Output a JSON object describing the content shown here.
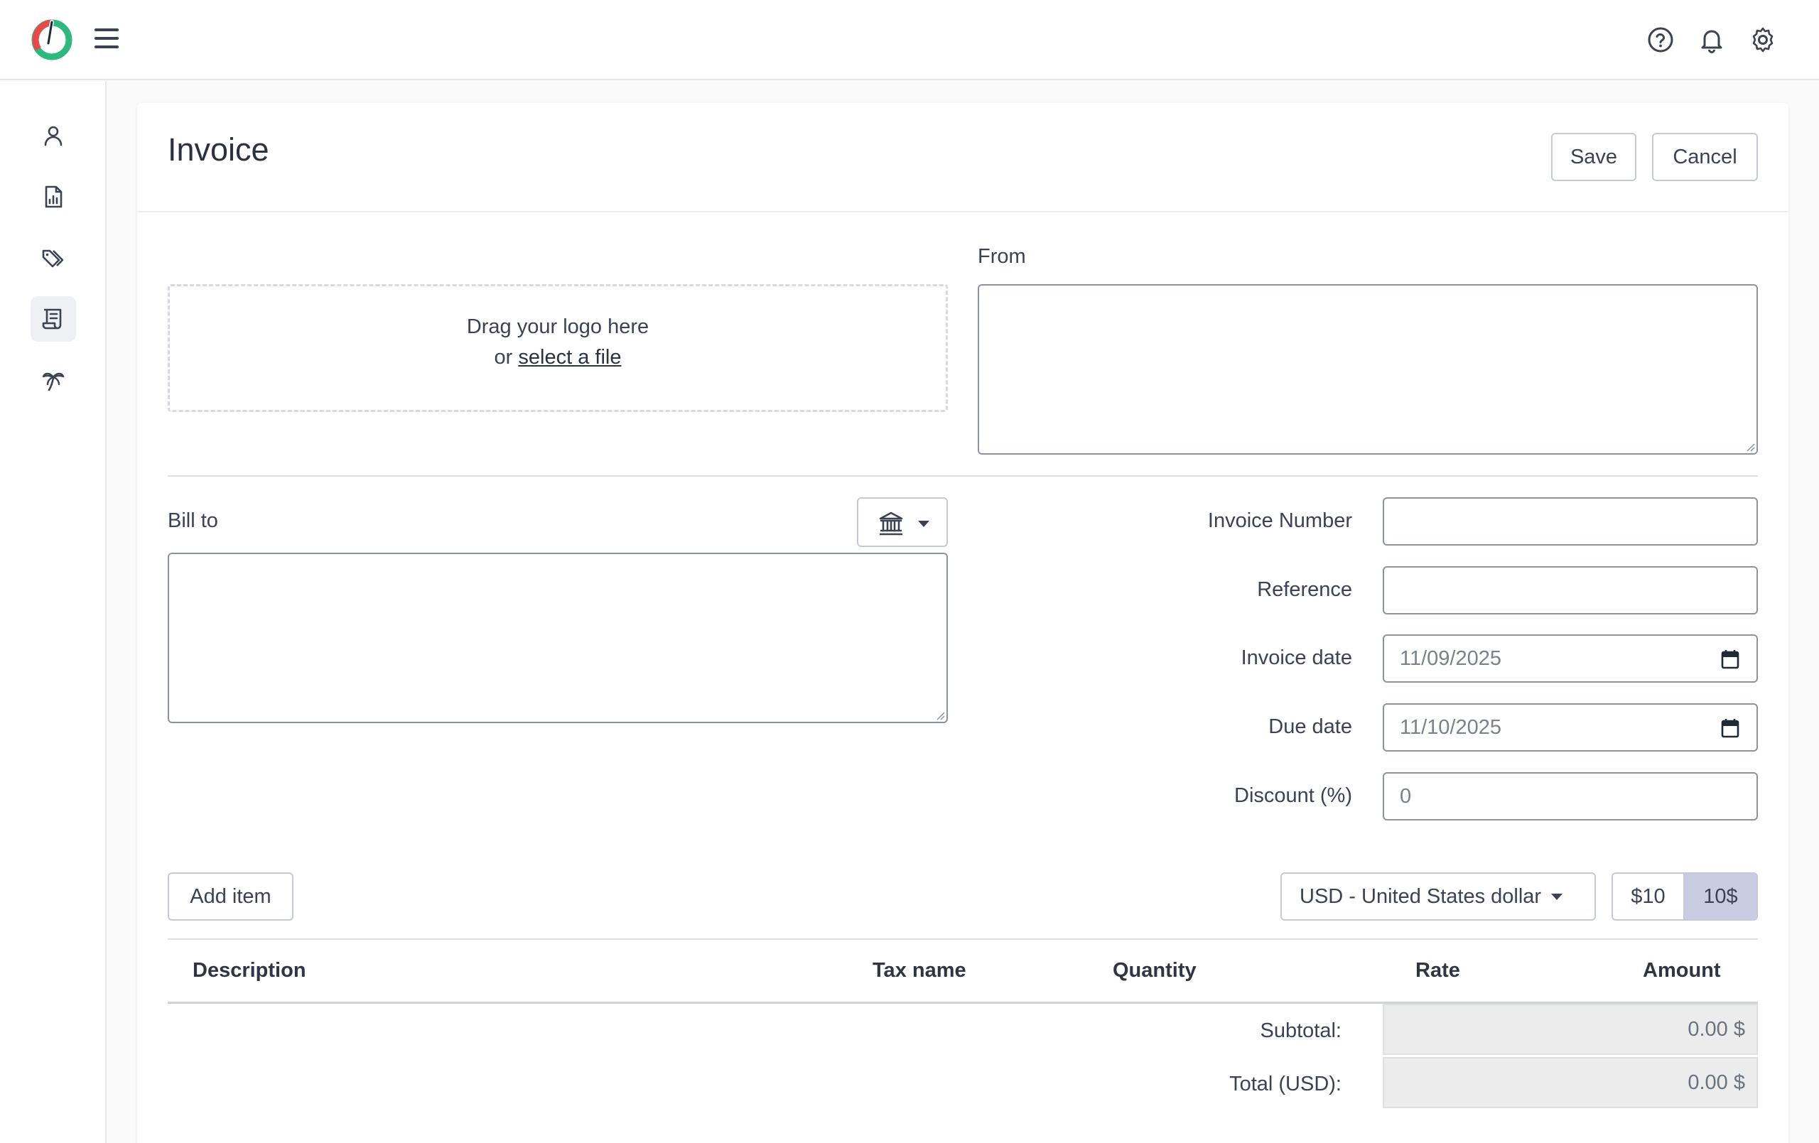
{
  "header": {
    "menu_icon": "hamburger-menu-icon",
    "help_icon": "help-circle-icon",
    "notifications_icon": "bell-icon",
    "settings_icon": "gear-icon"
  },
  "sidebar": {
    "items": [
      {
        "icon": "user-icon",
        "active": false
      },
      {
        "icon": "report-icon",
        "active": false
      },
      {
        "icon": "tags-icon",
        "active": false
      },
      {
        "icon": "invoice-icon",
        "active": true
      },
      {
        "icon": "palm-tree-icon",
        "active": false
      }
    ]
  },
  "page": {
    "title": "Invoice",
    "save_label": "Save",
    "cancel_label": "Cancel"
  },
  "logo_upload": {
    "line1": "Drag your logo here",
    "line2_prefix": "or",
    "link_text": "select a file"
  },
  "from": {
    "label": "From",
    "value": ""
  },
  "bill_to": {
    "label": "Bill to",
    "value": "",
    "picker_icon": "bank-icon"
  },
  "fields": {
    "invoice_number": {
      "label": "Invoice Number",
      "value": ""
    },
    "reference": {
      "label": "Reference",
      "value": ""
    },
    "invoice_date": {
      "label": "Invoice date",
      "value": "11/09/2025"
    },
    "due_date": {
      "label": "Due date",
      "value": "11/10/2025"
    },
    "discount": {
      "label": "Discount (%)",
      "value": "0"
    }
  },
  "items": {
    "add_item_label": "Add item",
    "currency": "USD - United States dollar",
    "format_options": [
      "$10",
      "10$"
    ],
    "format_selected": "10$",
    "columns": [
      "Description",
      "Tax name",
      "Quantity",
      "Rate",
      "Amount"
    ],
    "rows": []
  },
  "totals": {
    "subtotal_label": "Subtotal:",
    "subtotal_value": "0.00 $",
    "total_label": "Total (USD):",
    "total_value": "0.00 $"
  },
  "colors": {
    "logo_green": "#2db87d",
    "logo_red": "#e84a4a",
    "format_active_bg": "#c9cde3"
  }
}
